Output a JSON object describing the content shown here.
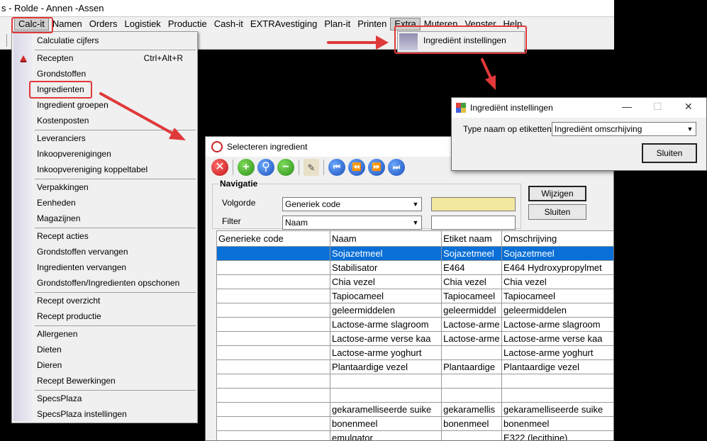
{
  "app": {
    "title": "s - Rolde - Annen -Assen"
  },
  "menubar": [
    "Calc-it",
    "Namen",
    "Orders",
    "Logistiek",
    "Productie",
    "Cash-it",
    "EXTRAvestiging",
    "Plan-it",
    "Printen",
    "Extra",
    "Muteren",
    "Venster",
    "Help"
  ],
  "calc_menu": {
    "items": [
      {
        "label": "Calculatie cijfers"
      },
      {
        "label": "Recepten",
        "shortcut": "Ctrl+Alt+R"
      },
      {
        "label": "Grondstoffen"
      },
      {
        "label": "Ingredienten"
      },
      {
        "label": "Ingredient groepen"
      },
      {
        "label": "Kostenposten"
      },
      {
        "label": "Leveranciers"
      },
      {
        "label": "Inkoopverenigingen"
      },
      {
        "label": "Inkoopvereniging koppeltabel"
      },
      {
        "label": "Verpakkingen"
      },
      {
        "label": "Eenheden"
      },
      {
        "label": "Magazijnen"
      },
      {
        "label": "Recept acties"
      },
      {
        "label": "Grondstoffen vervangen"
      },
      {
        "label": "Ingredienten vervangen"
      },
      {
        "label": "Grondstoffen/Ingredienten opschonen"
      },
      {
        "label": "Recept overzicht"
      },
      {
        "label": "Recept productie"
      },
      {
        "label": "Allergenen"
      },
      {
        "label": "Dieten"
      },
      {
        "label": "Dieren"
      },
      {
        "label": "Recept Bewerkingen"
      },
      {
        "label": "SpecsPlaza"
      },
      {
        "label": "SpecsPlaza instellingen"
      }
    ]
  },
  "extra_menu": {
    "item": "Ingrediënt instellingen"
  },
  "select_window": {
    "title": "Selecteren ingredient",
    "nav_legend": "Navigatie",
    "volgorde_label": "Volgorde",
    "volgorde_value": "Generiek code",
    "filter_label": "Filter",
    "filter_value": "Naam",
    "btn_edit": "Wijzigen",
    "btn_close": "Sluiten",
    "columns": [
      "Generieke code",
      "Naam",
      "Etiket naam",
      "Omschrijving"
    ],
    "rows": [
      [
        "",
        "Sojazetmeel",
        "Sojazetmeel",
        "Sojazetmeel"
      ],
      [
        "",
        "Stabilisator",
        "E464",
        "E464 Hydroxypropylmet"
      ],
      [
        "",
        "Chia vezel",
        "Chia vezel",
        "Chia vezel"
      ],
      [
        "",
        "Tapiocameel",
        "Tapiocameel",
        "Tapiocameel"
      ],
      [
        "",
        "geleermiddelen",
        "geleermiddel",
        "geleermiddelen"
      ],
      [
        "",
        "Lactose-arme slagroom",
        "Lactose-arme",
        "Lactose-arme slagroom"
      ],
      [
        "",
        "Lactose-arme verse kaa",
        "Lactose-arme",
        "Lactose-arme verse kaa"
      ],
      [
        "",
        "Lactose-arme yoghurt",
        "",
        "Lactose-arme yoghurt"
      ],
      [
        "",
        "Plantaardige vezel",
        "Plantaardige",
        "Plantaardige vezel"
      ],
      [
        "",
        "",
        "",
        ""
      ],
      [
        "",
        "",
        "",
        ""
      ],
      [
        "",
        "gekaramelliseerde suike",
        "gekaramellis",
        "gekaramelliseerde suike"
      ],
      [
        "",
        "bonenmeel",
        "bonenmeel",
        "bonenmeel"
      ],
      [
        "",
        "emulgator",
        "",
        "E322 (lecithine)"
      ]
    ]
  },
  "dialog": {
    "title": "Ingrediënt instellingen",
    "label": "Type naam op etiketten:",
    "value": "Ingrediënt omscrhijving",
    "button": "Sluiten"
  },
  "colors": {
    "highlight": "#e0393a",
    "selection": "#0a6fd6"
  }
}
